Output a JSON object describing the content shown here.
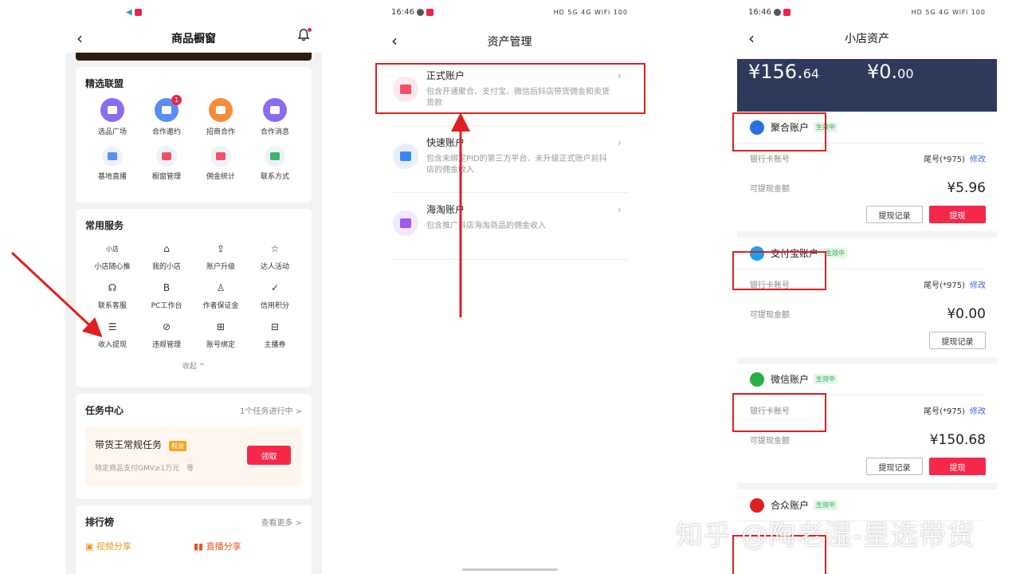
{
  "panel1": {
    "nav_title": "商品橱窗",
    "alliance": {
      "title": "精选联盟",
      "items": [
        {
          "label": "选品广场",
          "icon": "cart-icon",
          "color": "#8b6cf0"
        },
        {
          "label": "合作邀约",
          "icon": "mail-icon",
          "color": "#5b8cf5",
          "badge": "1"
        },
        {
          "label": "招商合作",
          "icon": "handshake-icon",
          "color": "#f58c3a"
        },
        {
          "label": "合作消息",
          "icon": "message-icon",
          "color": "#8b6cf0"
        },
        {
          "label": "基地直播",
          "icon": "shield-icon",
          "color": "#5b8cf5"
        },
        {
          "label": "橱窗管理",
          "icon": "bag-icon",
          "color": "#f5506a"
        },
        {
          "label": "佣金统计",
          "icon": "wallet-icon",
          "color": "#f5506a"
        },
        {
          "label": "联系方式",
          "icon": "contact-icon",
          "color": "#3ab56a"
        }
      ]
    },
    "services": {
      "title": "常用服务",
      "items": [
        {
          "label": "小店随心推",
          "icon": "store-promo-icon",
          "glyph": "小店"
        },
        {
          "label": "我的小店",
          "icon": "store-icon",
          "glyph": "⌂"
        },
        {
          "label": "账户升级",
          "icon": "upgrade-icon",
          "glyph": "⇪"
        },
        {
          "label": "达人活动",
          "icon": "star-icon",
          "glyph": "☆"
        },
        {
          "label": "联系客服",
          "icon": "headset-icon",
          "glyph": "☊"
        },
        {
          "label": "PC工作台",
          "icon": "workbench-icon",
          "glyph": "B"
        },
        {
          "label": "作者保证金",
          "icon": "user-coin-icon",
          "glyph": "♙"
        },
        {
          "label": "信用积分",
          "icon": "credit-shield-icon",
          "glyph": "✓"
        },
        {
          "label": "收入提现",
          "icon": "withdraw-icon",
          "glyph": "☰"
        },
        {
          "label": "违规管理",
          "icon": "violation-icon",
          "glyph": "⊘"
        },
        {
          "label": "账号绑定",
          "icon": "account-bind-icon",
          "glyph": "⊞"
        },
        {
          "label": "主播券",
          "icon": "coupon-icon",
          "glyph": "⊟"
        }
      ],
      "collapse_label": "收起 ^"
    },
    "task": {
      "title": "任务中心",
      "more": "1个任务进行中 >",
      "task_title": "带货王常规任务",
      "task_tag": "权益",
      "task_desc": "特定商品支付GMV≥1万元　等",
      "claim_label": "领取"
    },
    "ranking": {
      "title": "排行榜",
      "more": "查看更多 >",
      "tab_video": "视频分享",
      "tab_live": "直播分享"
    }
  },
  "panel2": {
    "time": "16:46",
    "status_right": "HD 5G 4G WiFi 100",
    "nav_title": "资产管理",
    "accounts": [
      {
        "name": "正式账户",
        "desc": "包含开通聚合、支付宝、微信后抖店带货佣金和卖货货款",
        "icon": "formal-account-icon",
        "color": "#fde8ec",
        "inner": "#f5506a"
      },
      {
        "name": "快速账户",
        "desc": "包含未绑定PID的第三方平台、未升级正式账户前抖店的佣金收入",
        "icon": "fast-account-icon",
        "color": "#e6f0fd",
        "inner": "#3a86f5"
      },
      {
        "name": "海淘账户",
        "desc": "包含推广抖店海淘商品的佣金收入",
        "icon": "overseas-account-icon",
        "color": "#f3e8fd",
        "inner": "#a058f0"
      }
    ]
  },
  "panel3": {
    "time": "16:46",
    "status_right": "HD 5G 4G WiFi 100",
    "nav_title": "小店资产",
    "amount1_main": "¥156.",
    "amount1_dec": "64",
    "amount2_main": "¥0.",
    "amount2_dec": "00",
    "card_label": "银行卡账号",
    "withdrawable_label": "可提现金额",
    "record_label": "提现记录",
    "withdraw_label": "提现",
    "edit_label": "修改",
    "active_tag": "生效中",
    "sections": [
      {
        "name": "聚合账户",
        "card": "尾号(*975)",
        "amount": "¥5.96",
        "icon": "aggregate-icon",
        "color": "#2a6fe0"
      },
      {
        "name": "支付宝账户",
        "card": "尾号(*975)",
        "amount": "¥0.00",
        "icon": "alipay-icon",
        "color": "#1aa0f0"
      },
      {
        "name": "微信账户",
        "card": "尾号(*975)",
        "amount": "¥150.68",
        "icon": "wechat-icon",
        "color": "#27b046"
      },
      {
        "name": "合众账户",
        "icon": "hezhong-icon",
        "color": "#e02020"
      }
    ]
  },
  "watermark": "知乎 @陶老湿-星选带货"
}
